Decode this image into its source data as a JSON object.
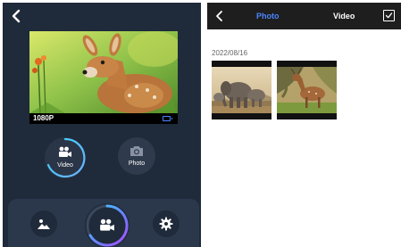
{
  "left_screen": {
    "resolution": "1080P",
    "modes": {
      "video_label": "Video",
      "photo_label": "Photo"
    },
    "icons": {
      "back": "chevron-left-icon",
      "battery": "battery-icon",
      "video": "video-camera-icon",
      "photo": "camera-icon",
      "gallery": "image-gallery-icon",
      "record": "video-camera-icon",
      "settings": "gear-icon"
    },
    "colors": {
      "background": "#1f2a3a",
      "panel": "#2b384c",
      "accent": "#4a86ff",
      "ring_gradient_start": "#38d6ff",
      "ring_gradient_end": "#b04cff"
    }
  },
  "right_screen": {
    "tabs": {
      "photo": "Photo",
      "video": "Video"
    },
    "active_tab": "Photo",
    "date_group": "2022/08/16",
    "thumbnails": [
      {
        "subject": "elephants"
      },
      {
        "subject": "deer"
      }
    ],
    "icons": {
      "back": "chevron-left-icon",
      "select": "checkbox-checked-icon"
    },
    "colors": {
      "top_bar": "#1e1e1e",
      "active_tab": "#4a86ff",
      "inactive_tab": "#ffffff"
    }
  }
}
